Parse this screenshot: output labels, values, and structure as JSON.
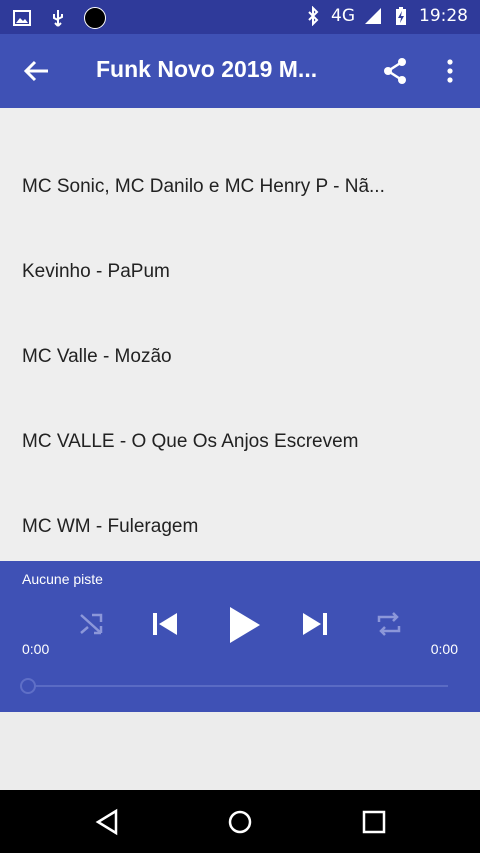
{
  "status": {
    "network": "4G",
    "time": "19:28"
  },
  "appbar": {
    "title": "Funk Novo 2019 M..."
  },
  "tracks": [
    "MC Sonic, MC Danilo e MC Henry P - Nã...",
    "Kevinho - PaPum",
    "MC Valle - Mozão",
    "MC VALLE - O Que Os Anjos Escrevem",
    "MC WM - Fuleragem"
  ],
  "player": {
    "track_label": "Aucune piste",
    "elapsed": "0:00",
    "duration": "0:00",
    "progress": 0
  },
  "colors": {
    "statusbar": "#2f3a9a",
    "primary": "#3f51b5",
    "list_bg": "#eeeeee",
    "navbar": "#000000"
  }
}
